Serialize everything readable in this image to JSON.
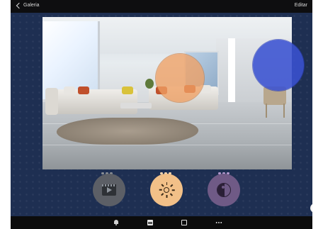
{
  "header": {
    "back_label": "Galeria",
    "edit_label": "Editar"
  },
  "actions": {
    "video": {
      "icon": "film-icon"
    },
    "light": {
      "icon": "sun-icon"
    },
    "color": {
      "icon": "yin-yang-icon"
    }
  },
  "help": {
    "label": "?"
  },
  "tabs": [
    "bell-icon",
    "gallery-icon",
    "camera-icon",
    "more-icon"
  ],
  "colors": {
    "background": "#1e2f52",
    "orange_marker": "#f0a064",
    "blue_marker": "#3a52d2",
    "light_button": "#f2c088",
    "color_button": "#6f5a86",
    "video_button": "#5c5f66"
  }
}
